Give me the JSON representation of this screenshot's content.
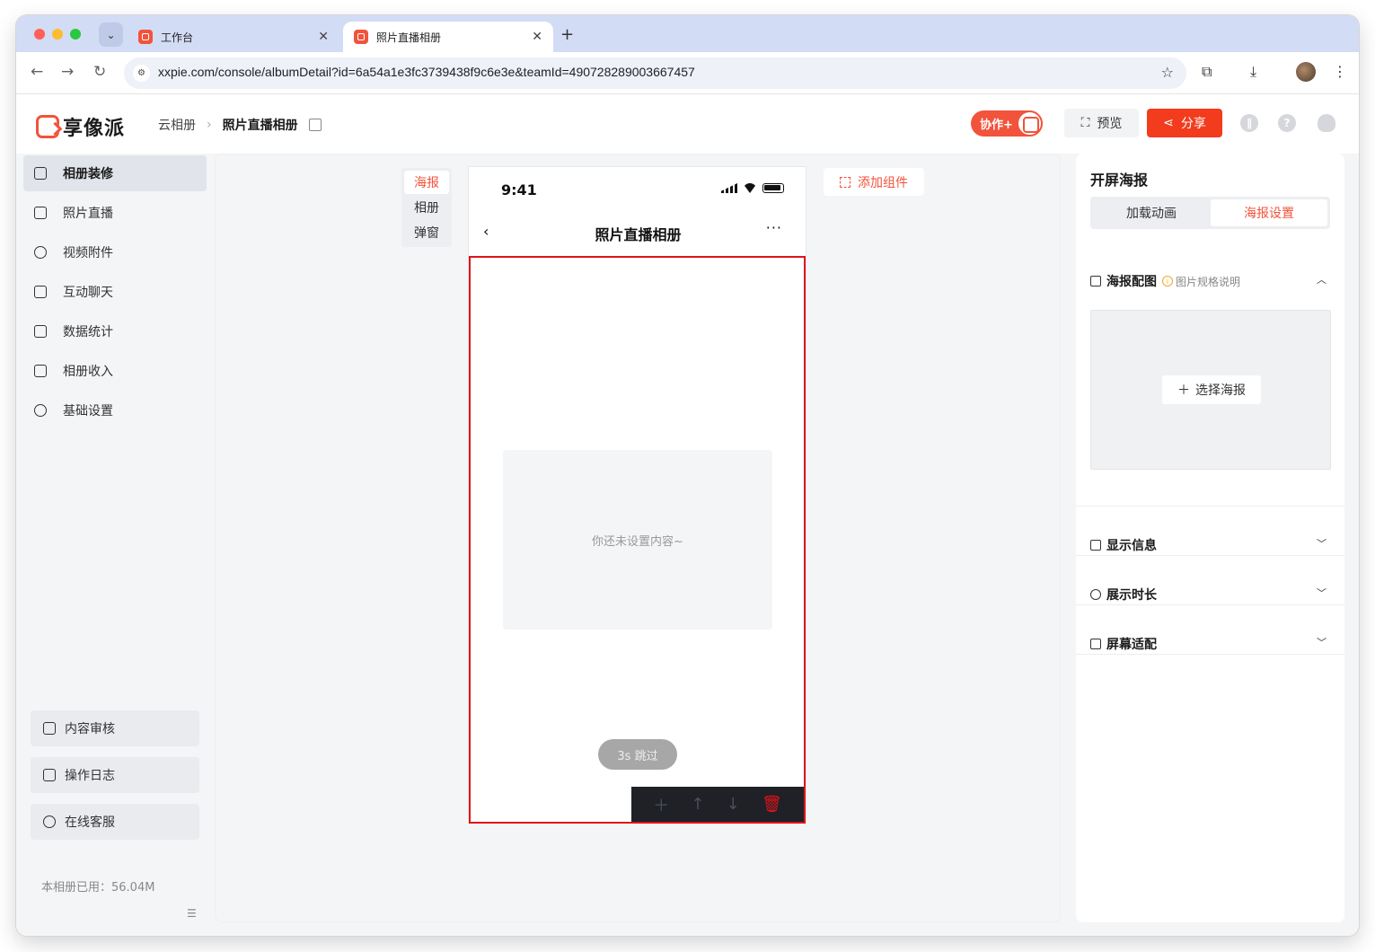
{
  "browser": {
    "tabs": [
      {
        "title": "工作台",
        "active": false
      },
      {
        "title": "照片直播相册",
        "active": true
      }
    ],
    "url": "xxpie.com/console/albumDetail?id=6a54a1e3fc3739438f9c6e3e&teamId=490728289003667457"
  },
  "header": {
    "logo_text": "享像派",
    "breadcrumb": [
      "云相册",
      "照片直播相册"
    ],
    "collab_label": "协作+",
    "preview_label": "预览",
    "share_label": "分享",
    "accent_color": "#f2533b"
  },
  "sidebar": {
    "items": [
      {
        "label": "相册装修",
        "icon": "scan-icon",
        "active": true
      },
      {
        "label": "照片直播",
        "icon": "image-icon",
        "active": false
      },
      {
        "label": "视频附件",
        "icon": "paperclip-icon",
        "active": false
      },
      {
        "label": "互动聊天",
        "icon": "chat-icon",
        "active": false
      },
      {
        "label": "数据统计",
        "icon": "stats-icon",
        "active": false
      },
      {
        "label": "相册收入",
        "icon": "store-icon",
        "active": false
      },
      {
        "label": "基础设置",
        "icon": "gear-icon",
        "active": false
      }
    ],
    "bottom": [
      {
        "label": "内容审核",
        "icon": "stamp-icon"
      },
      {
        "label": "操作日志",
        "icon": "log-icon"
      },
      {
        "label": "在线客服",
        "icon": "headset-icon"
      }
    ],
    "usage_text": "本相册已用：56.04M"
  },
  "canvas": {
    "seg_tabs": [
      {
        "label": "海报",
        "active": true
      },
      {
        "label": "相册",
        "active": false
      },
      {
        "label": "弹窗",
        "active": false
      }
    ],
    "add_component_label": "添加组件",
    "phone": {
      "time": "9:41",
      "title": "照片直播相册",
      "more": "···",
      "placeholder": "你还未设置内容~",
      "skip": "3s 跳过"
    }
  },
  "right_panel": {
    "title": "开屏海报",
    "seg": [
      {
        "label": "加载动画",
        "active": false
      },
      {
        "label": "海报设置",
        "active": true
      }
    ],
    "poster_section": {
      "label": "海报配图",
      "help": "图片规格说明",
      "choose_label": "选择海报"
    },
    "sections": [
      "显示信息",
      "展示时长",
      "屏幕适配"
    ]
  }
}
